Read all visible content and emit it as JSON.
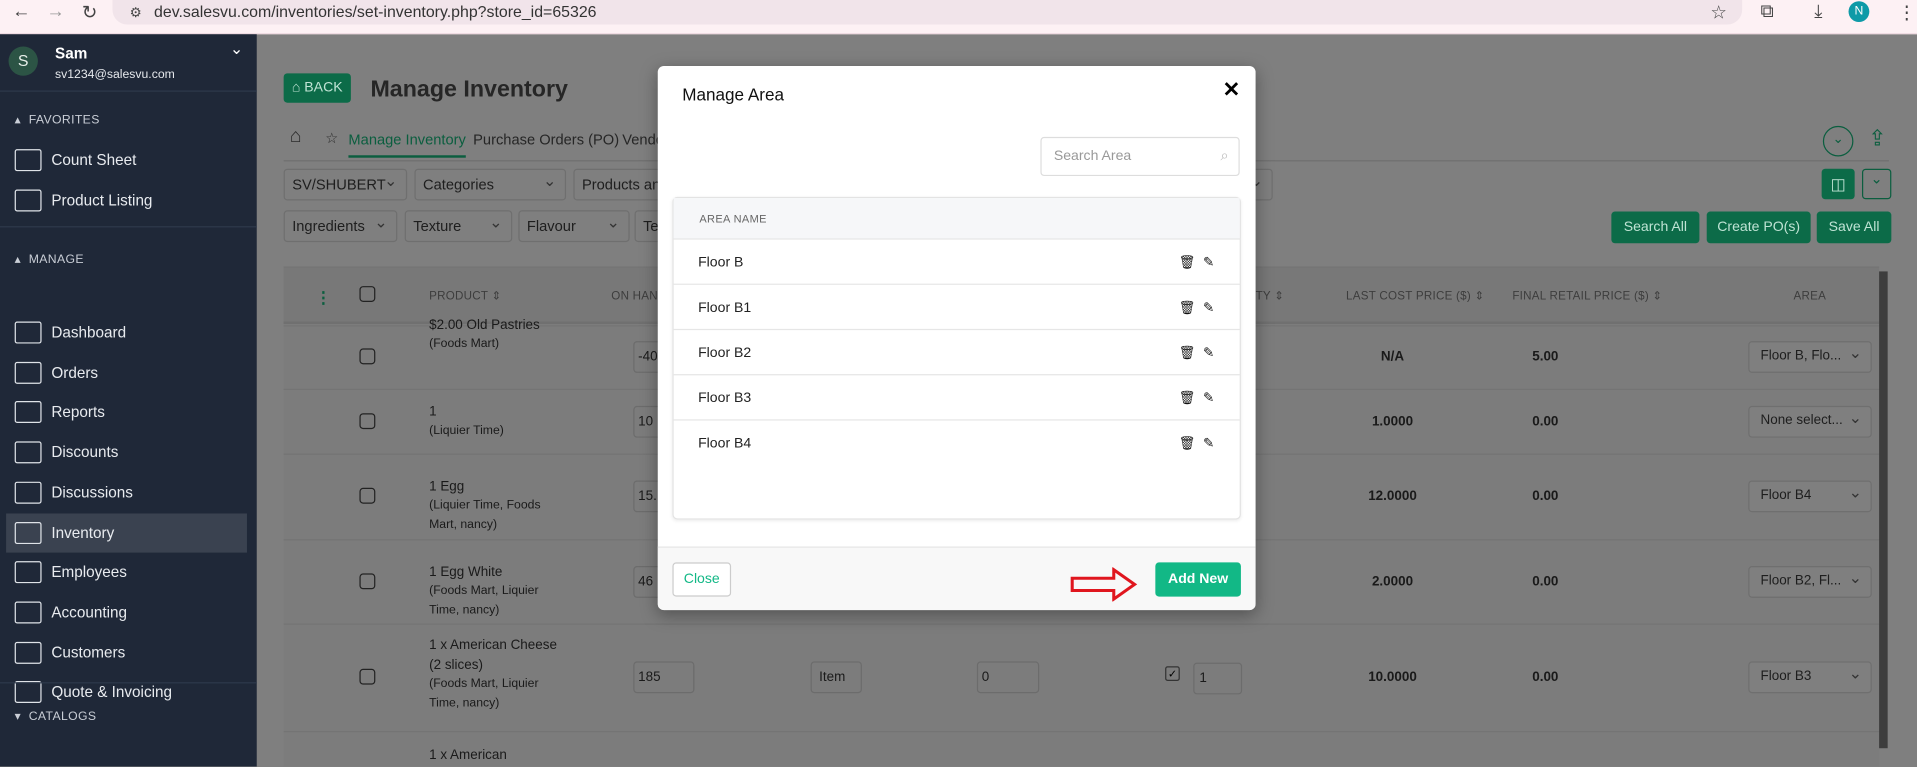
{
  "browser": {
    "url": "dev.salesvu.com/inventories/set-inventory.php?store_id=65326",
    "profile_initial": "N"
  },
  "user": {
    "initial": "S",
    "name": "Sam",
    "email": "sv1234@salesvu.com"
  },
  "sidebar": {
    "favorites_label": "FAVORITES",
    "favorites": [
      {
        "label": "Count Sheet"
      },
      {
        "label": "Product Listing"
      }
    ],
    "manage_label": "MANAGE",
    "manage": [
      {
        "label": "Dashboard"
      },
      {
        "label": "Orders"
      },
      {
        "label": "Reports"
      },
      {
        "label": "Discounts"
      },
      {
        "label": "Discussions"
      },
      {
        "label": "Inventory",
        "active": true
      },
      {
        "label": "Employees"
      },
      {
        "label": "Accounting"
      },
      {
        "label": "Customers"
      },
      {
        "label": "Quote & Invoicing"
      }
    ],
    "catalogs_label": "CATALOGS"
  },
  "header": {
    "back_label": "BACK",
    "title": "Manage Inventory"
  },
  "tabs": [
    {
      "label": "Manage Inventory",
      "active": true
    },
    {
      "label": "Purchase Orders (PO)"
    },
    {
      "label": "Vendo"
    }
  ],
  "filters": {
    "row1": [
      "SV/SHUBERT",
      "Categories",
      "Products and"
    ],
    "row2": [
      "Ingredients",
      "Texture",
      "Flavour",
      "Te"
    ]
  },
  "actions": {
    "search_all": "Search All",
    "create_po": "Create PO(s)",
    "save_all": "Save All"
  },
  "table": {
    "headers": {
      "product": "PRODUCT",
      "on_hand": "ON HAN",
      "qty": "TY",
      "last_cost": "LAST COST PRICE ($)",
      "final_retail": "FINAL RETAIL PRICE ($)",
      "area": "AREA"
    },
    "rows": [
      {
        "name": "$2.00 Old Pastries",
        "stores": "(Foods Mart)",
        "on_hand": "-40",
        "last_cost": "N/A",
        "final_retail": "5.00",
        "area": "Floor B, Flo..."
      },
      {
        "name": "1",
        "stores": "(Liquier Time)",
        "on_hand": "10",
        "last_cost": "1.0000",
        "final_retail": "0.00",
        "area": "None select..."
      },
      {
        "name": "1 Egg",
        "stores": "(Liquier Time, Foods Mart, nancy)",
        "on_hand": "15.",
        "last_cost": "12.0000",
        "final_retail": "0.00",
        "area": "Floor B4"
      },
      {
        "name": "1 Egg White",
        "stores": "(Foods Mart, Liquier Time, nancy)",
        "on_hand": "46",
        "last_cost": "2.0000",
        "final_retail": "0.00",
        "area": "Floor B2, Fl..."
      },
      {
        "name": "1 x American Cheese (2 slices)",
        "stores": "(Foods Mart, Liquier Time, nancy)",
        "on_hand": "185",
        "unit": "Item",
        "par": "0",
        "qty_checked": true,
        "qty": "1",
        "last_cost": "10.0000",
        "final_retail": "0.00",
        "area": "Floor B3"
      },
      {
        "name": "1 x American",
        "stores": ""
      }
    ]
  },
  "modal": {
    "title": "Manage Area",
    "search_placeholder": "Search Area",
    "column_header": "AREA NAME",
    "areas": [
      "Floor B",
      "Floor B1",
      "Floor B2",
      "Floor B3",
      "Floor B4"
    ],
    "close_label": "Close",
    "add_new_label": "Add New"
  },
  "colors": {
    "brand_green": "#0c6b48",
    "modal_green": "#12b886",
    "sidebar_bg": "#1f2838",
    "arrow_red": "#e0161e"
  }
}
